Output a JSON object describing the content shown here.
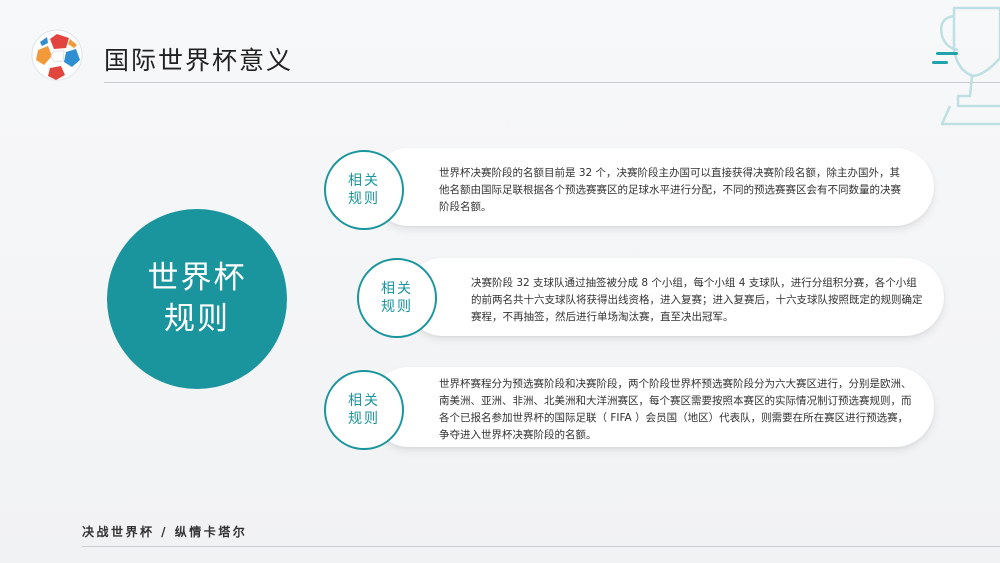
{
  "header": {
    "title": "国际世界杯意义"
  },
  "main_circle": {
    "label": "世界杯规则"
  },
  "cards": [
    {
      "tag": "相关规则",
      "text": "世界杯决赛阶段的名额目前是 32 个，决赛阶段主办国可以直接获得决赛阶段名额，除主办国外，其他名额由国际足联根据各个预选赛赛区的足球水平进行分配，不同的预选赛赛区会有不同数量的决赛阶段名额。"
    },
    {
      "tag": "相关规则",
      "text": "决赛阶段 32 支球队通过抽签被分成 8 个小组，每个小组 4 支球队，进行分组积分赛，各个小组的前两名共十六支球队将获得出线资格，进入复赛；进入复赛后，十六支球队按照既定的规则确定赛程，不再抽签，然后进行单场淘汰赛，直至决出冠军。"
    },
    {
      "tag": "相关规则",
      "text": "世界杯赛程分为预选赛阶段和决赛阶段，两个阶段世界杯预选赛阶段分为六大赛区进行，分别是欧洲、南美洲、亚洲、非洲、北美洲和大洋洲赛区，每个赛区需要按照本赛区的实际情况制订预选赛规则，而各个已报名参加世界杯的国际足联（ FIFA ）会员国（地区）代表队，则需要在所在赛区进行预选赛，争夺进入世界杯决赛阶段的名额。"
    }
  ],
  "footer": {
    "text": "决战世界杯 / 纵情卡塔尔"
  },
  "colors": {
    "accent": "#1a959d",
    "accent_light": "#1fa3ad",
    "ball_red": "#e2453d",
    "ball_blue": "#2f8fd1",
    "ball_orange": "#f29a3a"
  },
  "icons": {
    "logo": "soccer-ball-icon",
    "corner": "trophy-icon"
  }
}
